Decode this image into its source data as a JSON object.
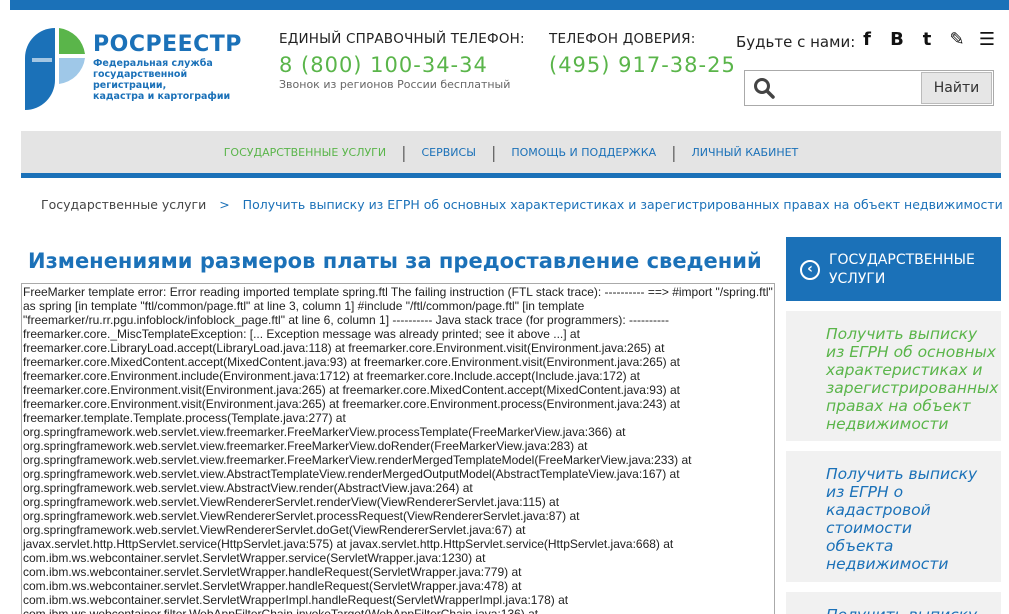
{
  "header": {
    "logo_name": "РОСРЕЕСТР",
    "logo_sub": [
      "Федеральная служба",
      "государственной регистрации,",
      "кадастра и картографии"
    ],
    "hotline_label": "ЕДИНЫЙ СПРАВОЧНЫЙ ТЕЛЕФОН:",
    "hotline_number": "8 (800) 100-34-34",
    "hotline_note": "Звонок из регионов России бесплатный",
    "trust_label": "ТЕЛЕФОН ДОВЕРИЯ:",
    "trust_number": "(495) 917-38-25",
    "social_label": "Будьте с нами:",
    "social_icons": [
      "facebook-icon",
      "vk-icon",
      "twitter-icon",
      "livejournal-icon",
      "rss-icon"
    ],
    "social_glyphs": [
      "f",
      "B",
      "t",
      "✎",
      "☰"
    ],
    "search_placeholder": "",
    "search_button": "Найти"
  },
  "nav": {
    "items": [
      "ГОСУДАРСТВЕННЫЕ УСЛУГИ",
      "СЕРВИСЫ",
      "ПОМОЩЬ И ПОДДЕРЖКА",
      "ЛИЧНЫЙ КАБИНЕТ"
    ],
    "separator": "|"
  },
  "breadcrumb": {
    "root": "Государственные услуги",
    "sep": ">",
    "current": "Получить выписку из ЕГРН об основных характеристиках и зарегистрированных правах на объект недвижимости"
  },
  "main": {
    "title": "Изменениями размеров платы за предоставление сведений",
    "error_lines": [
      "FreeMarker template error: Error reading imported template spring.ftl The failing instruction (FTL stack trace): ---------- ==> #import \"/spring.ftl\"",
      "as spring [in template \"ftl/common/page.ftl\" at line 3, column 1] #include \"/ftl/common/page.ftl\" [in template",
      "\"freemarker/ru.rr.pgu.infoblock/infoblock_page.ftl\" at line 6, column 1] ---------- Java stack trace (for programmers): ----------",
      "freemarker.core._MiscTemplateException: [... Exception message was already printed; see it above ...] at",
      "freemarker.core.LibraryLoad.accept(LibraryLoad.java:118) at freemarker.core.Environment.visit(Environment.java:265) at",
      "freemarker.core.MixedContent.accept(MixedContent.java:93) at freemarker.core.Environment.visit(Environment.java:265) at",
      "freemarker.core.Environment.include(Environment.java:1712) at freemarker.core.Include.accept(Include.java:172) at",
      "freemarker.core.Environment.visit(Environment.java:265) at freemarker.core.MixedContent.accept(MixedContent.java:93) at",
      "freemarker.core.Environment.visit(Environment.java:265) at freemarker.core.Environment.process(Environment.java:243) at",
      "freemarker.template.Template.process(Template.java:277) at",
      "org.springframework.web.servlet.view.freemarker.FreeMarkerView.processTemplate(FreeMarkerView.java:366) at",
      "org.springframework.web.servlet.view.freemarker.FreeMarkerView.doRender(FreeMarkerView.java:283) at",
      "org.springframework.web.servlet.view.freemarker.FreeMarkerView.renderMergedTemplateModel(FreeMarkerView.java:233) at",
      "org.springframework.web.servlet.view.AbstractTemplateView.renderMergedOutputModel(AbstractTemplateView.java:167) at",
      "org.springframework.web.servlet.view.AbstractView.render(AbstractView.java:264) at",
      "org.springframework.web.servlet.ViewRendererServlet.renderView(ViewRendererServlet.java:115) at",
      "org.springframework.web.servlet.ViewRendererServlet.processRequest(ViewRendererServlet.java:87) at",
      "org.springframework.web.servlet.ViewRendererServlet.doGet(ViewRendererServlet.java:67) at",
      "javax.servlet.http.HttpServlet.service(HttpServlet.java:575) at javax.servlet.http.HttpServlet.service(HttpServlet.java:668) at",
      "com.ibm.ws.webcontainer.servlet.ServletWrapper.service(ServletWrapper.java:1230) at",
      "com.ibm.ws.webcontainer.servlet.ServletWrapper.handleRequest(ServletWrapper.java:779) at",
      "com.ibm.ws.webcontainer.servlet.ServletWrapper.handleRequest(ServletWrapper.java:478) at",
      "com.ibm.ws.webcontainer.servlet.ServletWrapperImpl.handleRequest(ServletWrapperImpl.java:178) at",
      "com.ibm.ws.webcontainer.filter.WebAppFilterChain.invokeTarget(WebAppFilterChain.java:136) at"
    ]
  },
  "sidebar": {
    "header_icon": "back-circle-icon",
    "header_glyph": "‹",
    "header_label_1": "ГОСУДАРСТВЕННЫЕ",
    "header_label_2": "УСЛУГИ",
    "card1": [
      "Получить выписку",
      "из ЕГРН об основных",
      "характеристиках и",
      "зарегистрированных",
      "правах на объект",
      "недвижимости"
    ],
    "card2": [
      "Получить выписку",
      "из ЕГРН о",
      "кадастровой",
      "стоимости",
      "объекта",
      "недвижимости"
    ],
    "card3": [
      "Получить выписку"
    ]
  },
  "colors": {
    "brand_blue": "#1b71b8",
    "brand_green": "#5ab54a",
    "nav_bg": "#e4e4e4"
  }
}
